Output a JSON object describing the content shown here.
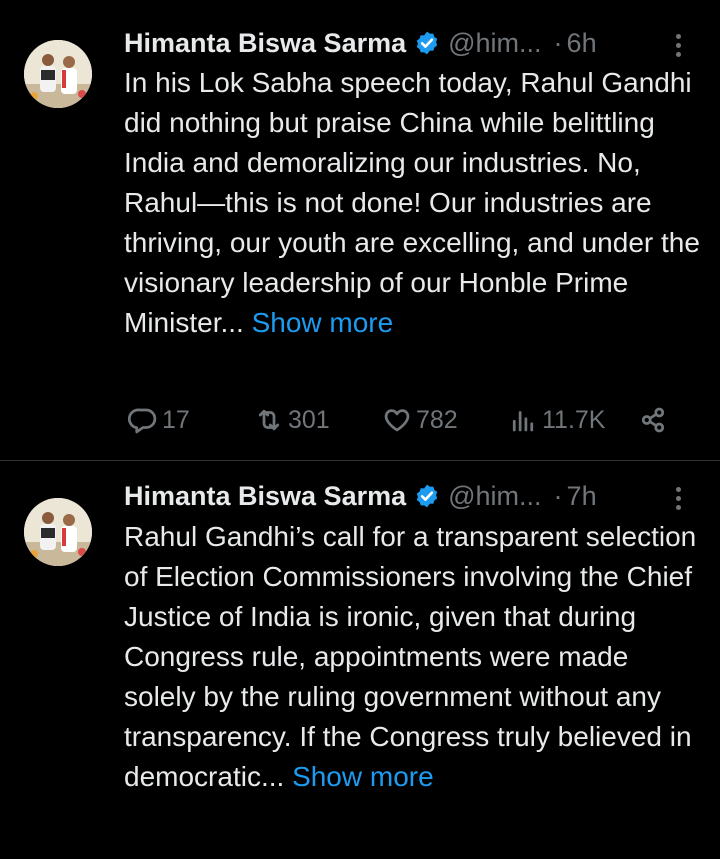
{
  "tweets": [
    {
      "name": "Himanta Biswa Sarma",
      "handle": "@him...",
      "separator": "·",
      "time": "6h",
      "text": "In his Lok Sabha speech today, Rahul Gandhi did nothing but praise China while belittling India and demoralizing our industries. No, Rahul—this is not done! Our industries are thriving, our youth are excelling, and under the visionary leadership of our Honble Prime Minister...",
      "show_more": "Show more",
      "replies": "17",
      "reposts": "301",
      "likes": "782",
      "views": "11.7K"
    },
    {
      "name": "Himanta Biswa Sarma",
      "handle": "@him...",
      "separator": "·",
      "time": "7h",
      "text": "Rahul Gandhi’s call for a transparent selection of Election Commissioners involving the Chief Justice of India is ironic, given that during Congress rule, appointments were made solely by the ruling government without any transparency. If the Congress truly believed in democratic...",
      "show_more": "Show more"
    }
  ],
  "colors": {
    "background": "#000000",
    "text": "#e7e9ea",
    "muted": "#71767b",
    "link": "#1d9bf0",
    "verified": "#1d9bf0",
    "divider": "#2f3336"
  },
  "icons": [
    "verified-badge-icon",
    "more-options-icon",
    "reply-icon",
    "repost-icon",
    "like-icon",
    "views-icon",
    "share-icon"
  ]
}
